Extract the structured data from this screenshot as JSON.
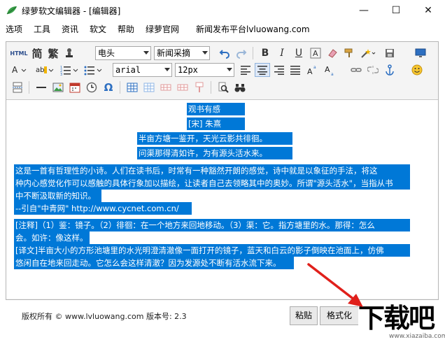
{
  "window": {
    "title": "绿萝软文编辑器 - [编辑器]",
    "minimize": "—",
    "maximize": "☐",
    "close": "✕"
  },
  "menu": [
    "选项",
    "工具",
    "资讯",
    "软文",
    "帮助",
    "绿萝官网",
    "新闻发布平台lvluowang.com"
  ],
  "toolbar": {
    "html_label": "HTML",
    "simplified": "简",
    "traditional": "繁",
    "font_combo": "电头",
    "style_combo": "新闻采摘",
    "bold": "B",
    "italic": "I",
    "underline": "U",
    "font_face": "arial",
    "font_size": "12px",
    "omega": "Ω"
  },
  "content": {
    "lines": [
      "观书有感",
      "[宋] 朱熹",
      "半亩方塘一鉴开，天光云影共徘徊。",
      "问渠那得清如许，为有源头活水来。",
      "    这是一首有哲理性的小诗。人们在读书后，时常有一种豁然开朗的感觉，诗中就是以象征的手法，将这",
      "种内心感觉化作可以感触的具体行象加以描绘，让读者自己去领略其中的奥妙。所谓\"源头活水\"，当指从书",
      "中不断汲取新的知识。",
      "   --引自\"中青网\" http://www.cycnet.com.cn/",
      "   [注释]（1）鉴：镜子。（2）徘徊：在一个地方来回地移动。（3）渠：它。指方塘里的水。那得：怎么",
      "会。如许：像这样。",
      "   [译文]半亩大小的方形池塘里的水光明澄清澈像一面打开的镜子，蓝天和白云的影子倒映在池面上，仿佛",
      "悠闲自在地来回走动。它怎么会这样清澈？因为发源处不断有活水流下来。"
    ]
  },
  "footer": {
    "copyright": "版权所有 © www.lvluowang.com 版本号: 2.3",
    "paste_button": "粘贴",
    "format_button": "格式化"
  },
  "watermark": {
    "main": "下载吧",
    "sub": "www.xiazaiba.com"
  },
  "colors": {
    "selection": "#0078d7",
    "app_icon": "#3aa04a",
    "arrow": "#e0201b"
  }
}
